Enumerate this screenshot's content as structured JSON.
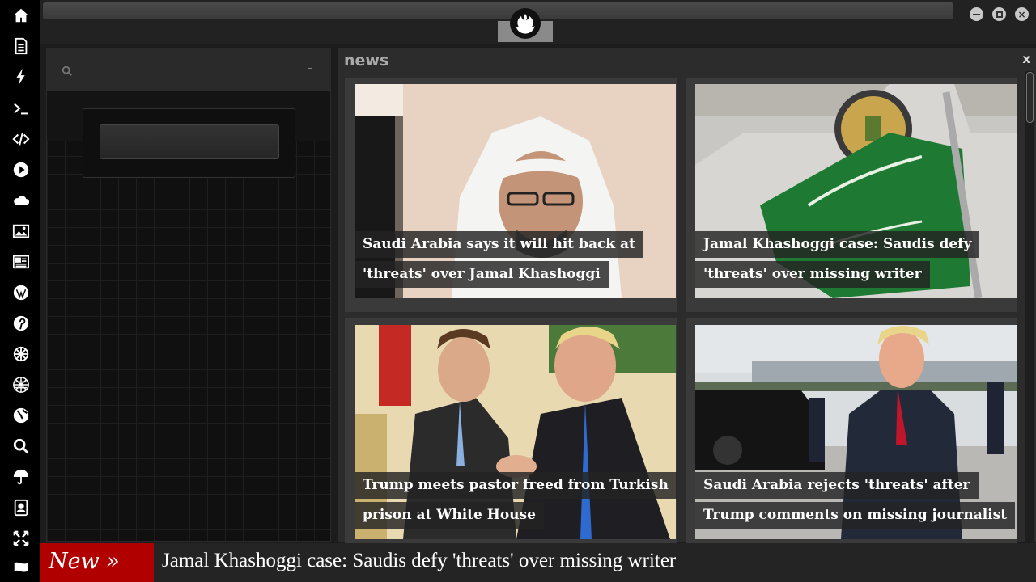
{
  "rail": {
    "icons": [
      "home-icon",
      "document-icon",
      "lightning-icon",
      "terminal-icon",
      "code-icon",
      "play-icon",
      "cloud-icon",
      "image-icon",
      "newspaper-icon",
      "wordpress-icon",
      "pinterest-icon",
      "gear-wheel-icon",
      "globe-mesh-icon",
      "earth-icon",
      "search-icon",
      "umbrella-icon",
      "contacts-icon",
      "expand-icon",
      "flag-icon"
    ]
  },
  "topbar": {
    "brand_icon": "rebel-alliance-logo",
    "window_controls": [
      "minimize",
      "maximize",
      "close"
    ]
  },
  "side_panel": {
    "search_placeholder": "",
    "collapse_label": "–"
  },
  "news": {
    "title": "news",
    "close_label": "x",
    "cards": [
      {
        "headline": "Saudi Arabia says it will hit back at 'threats' over Jamal Khashoggi"
      },
      {
        "headline": "Jamal Khashoggi case: Saudis defy 'threats' over missing writer"
      },
      {
        "headline": "Trump meets pastor freed from Turkish prison at White House"
      },
      {
        "headline": "Saudi Arabia rejects 'threats' after Trump comments on missing journalist"
      }
    ]
  },
  "ticker": {
    "label": "New »",
    "text": "Jamal Khashoggi case: Saudis defy 'threats' over missing writer"
  },
  "colors": {
    "ticker_label_bg": "#b00000",
    "rail_bg": "#000000",
    "panel_bg": "#2c2c2c"
  }
}
